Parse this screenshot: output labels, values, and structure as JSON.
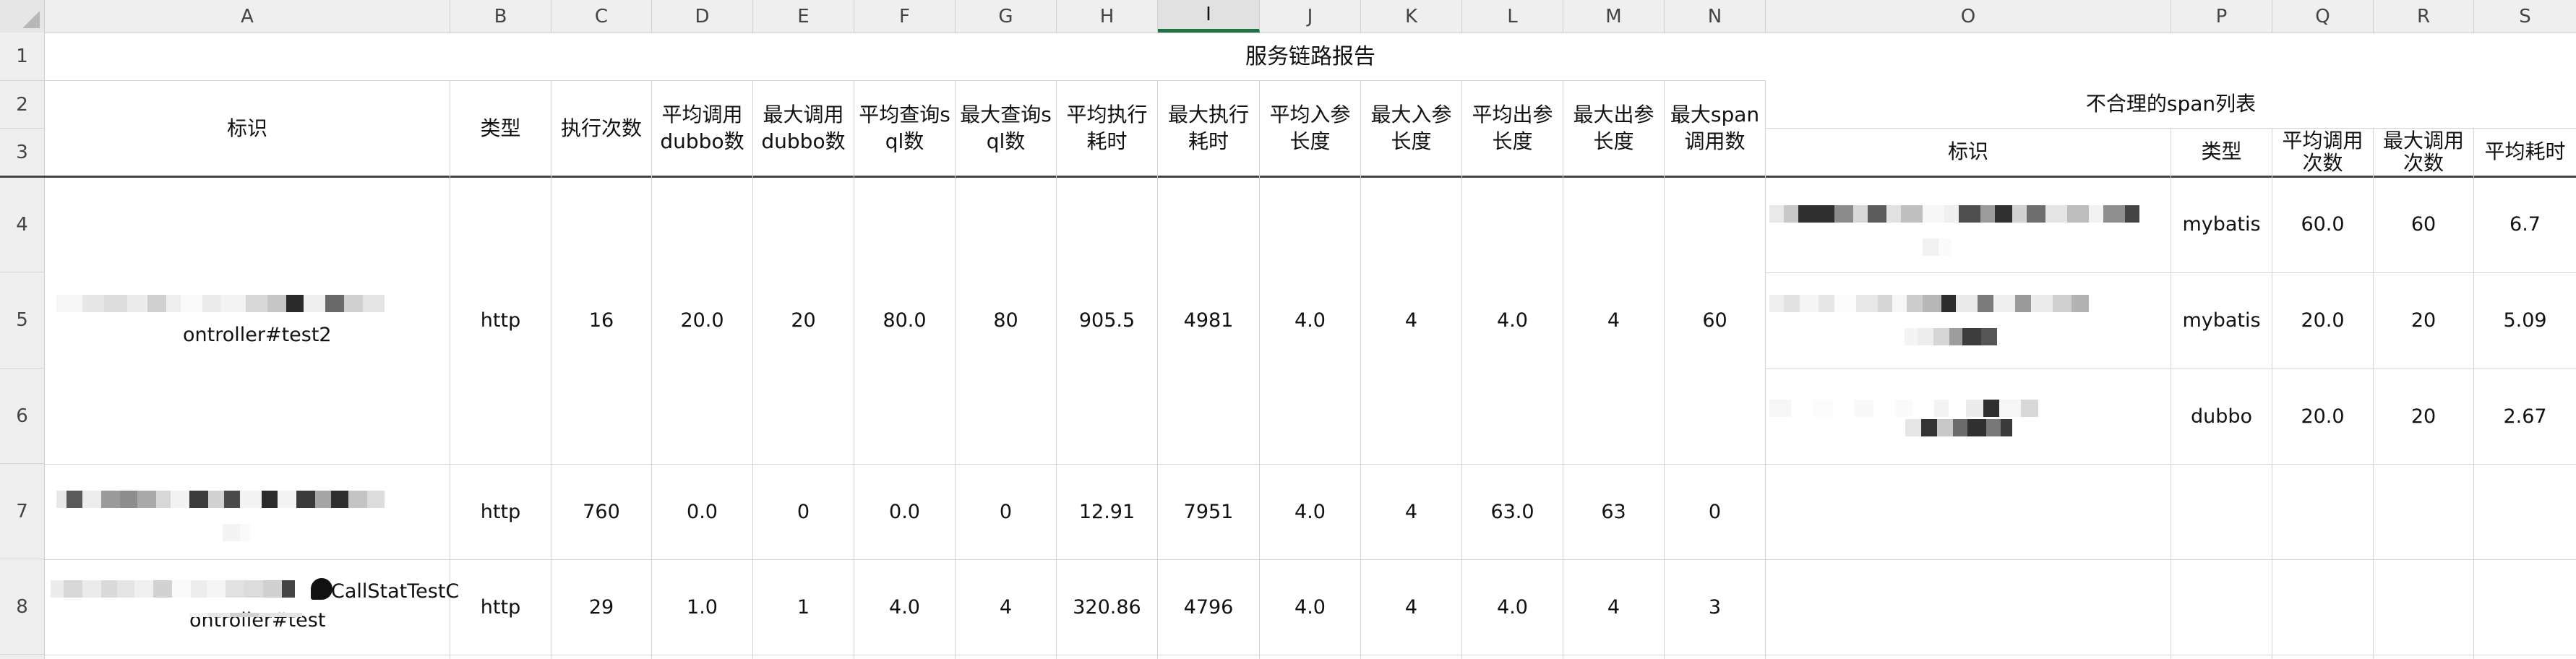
{
  "columns": [
    "A",
    "B",
    "C",
    "D",
    "E",
    "F",
    "G",
    "H",
    "I",
    "J",
    "K",
    "L",
    "M",
    "N",
    "O",
    "P",
    "Q",
    "R",
    "S"
  ],
  "active_column": "I",
  "rows": [
    "1",
    "2",
    "3",
    "4",
    "5",
    "6",
    "7",
    "8"
  ],
  "sheet": {
    "title": "服务链路报告",
    "headers": {
      "id": "标识",
      "type": "类型",
      "exec_count": "执行次数",
      "avg_dubbo_1": "平均调用",
      "avg_dubbo_2": "dubbo数",
      "max_dubbo_1": "最大调用",
      "max_dubbo_2": "dubbo数",
      "avg_sql_1": "平均查询s",
      "avg_sql_2": "ql数",
      "max_sql_1": "最大查询s",
      "max_sql_2": "ql数",
      "avg_time_1": "平均执行",
      "avg_time_2": "耗时",
      "max_time_1": "最大执行",
      "max_time_2": "耗时",
      "avg_in_1": "平均入参",
      "avg_in_2": "长度",
      "max_in_1": "最大入参",
      "max_in_2": "长度",
      "avg_out_1": "平均出参",
      "avg_out_2": "长度",
      "max_out_1": "最大出参",
      "max_out_2": "长度",
      "max_span_1": "最大span",
      "max_span_2": "调用数",
      "span_group": "不合理的span列表",
      "span_id": "标识",
      "span_type": "类型",
      "span_avg_1": "平均调用",
      "span_avg_2": "次数",
      "span_max_1": "最大调用",
      "span_max_2": "次数",
      "span_avg_time": "平均耗时"
    },
    "records": [
      {
        "id_visible": "ontroller#test2",
        "type": "http",
        "exec_count": "16",
        "avg_dubbo": "20.0",
        "max_dubbo": "20",
        "avg_sql": "80.0",
        "max_sql": "80",
        "avg_time": "905.5",
        "max_time": "4981",
        "avg_in": "4.0",
        "max_in": "4",
        "avg_out": "4.0",
        "max_out": "4",
        "max_span": "60"
      },
      {
        "id_visible": "",
        "type": "http",
        "exec_count": "760",
        "avg_dubbo": "0.0",
        "max_dubbo": "0",
        "avg_sql": "0.0",
        "max_sql": "0",
        "avg_time": "12.91",
        "max_time": "7951",
        "avg_in": "4.0",
        "max_in": "4",
        "avg_out": "63.0",
        "max_out": "63",
        "max_span": "0"
      },
      {
        "id_visible_1": "CallStatTestC",
        "id_visible_2": "ontroller#test",
        "type": "http",
        "exec_count": "29",
        "avg_dubbo": "1.0",
        "max_dubbo": "1",
        "avg_sql": "4.0",
        "max_sql": "4",
        "avg_time": "320.86",
        "max_time": "4796",
        "avg_in": "4.0",
        "max_in": "4",
        "avg_out": "4.0",
        "max_out": "4",
        "max_span": "3"
      }
    ],
    "spans": [
      {
        "type": "mybatis",
        "avg_calls": "60.0",
        "max_calls": "60",
        "avg_time": "6.7"
      },
      {
        "type": "mybatis",
        "avg_calls": "20.0",
        "max_calls": "20",
        "avg_time": "5.09"
      },
      {
        "type": "dubbo",
        "avg_calls": "20.0",
        "max_calls": "20",
        "avg_time": "2.67"
      }
    ]
  }
}
